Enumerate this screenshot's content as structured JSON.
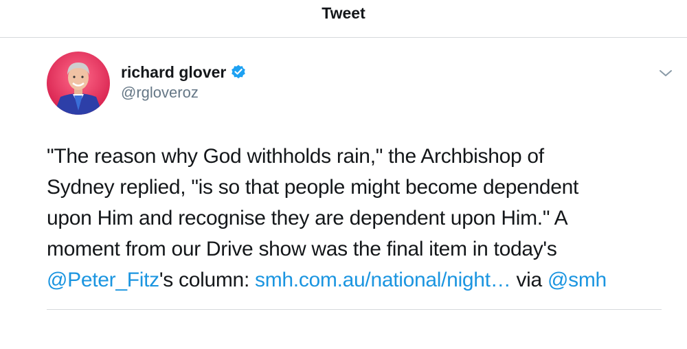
{
  "header": {
    "title": "Tweet"
  },
  "author": {
    "display_name": "richard glover",
    "handle": "@rgloveroz",
    "avatar_icon": "profile-photo",
    "verified_icon": "verified-badge-icon"
  },
  "tweet": {
    "lines": [
      "\"The reason why God withholds rain,\" the Archbishop of",
      "Sydney replied, \"is so that people might become dependent",
      "upon Him and recognise they are dependent upon Him.\" A",
      "moment from our Drive show was the final item in today's"
    ],
    "mention_peter": "@Peter_Fitz",
    "after_mention": "'s column: ",
    "url": "smh.com.au/national/night…",
    "via": " via ",
    "mention_smh": "@smh"
  },
  "colors": {
    "link": "#1b95e0",
    "verified": "#1da1f2",
    "text": "#14171a",
    "secondary": "#657786",
    "divider": "#d6d9dc"
  }
}
